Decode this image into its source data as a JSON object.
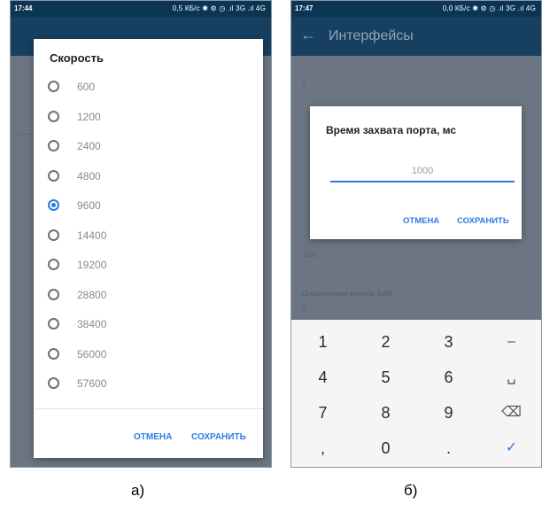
{
  "screen_a": {
    "statusbar": {
      "time": "17:44",
      "status": "0,5 КБ/с ✱ ⚙ ◷ .ıl 3G .ıl 4G"
    },
    "dialog": {
      "title": "Скорость",
      "options": [
        "600",
        "1200",
        "2400",
        "4800",
        "9600",
        "14400",
        "19200",
        "28800",
        "38400",
        "56000",
        "57600"
      ],
      "selected": "9600",
      "cancel_label": "ОТМЕНА",
      "save_label": "СОХРАНИТЬ"
    },
    "caption": "а)"
  },
  "screen_b": {
    "statusbar": {
      "time": "17:47",
      "status": "0,0 КБ/с ✱ ⚙ ◷ .ıl 3G .ıl 4G"
    },
    "appbar": {
      "back_icon": "arrow-left-icon",
      "title": "Интерфейсы"
    },
    "background": {
      "value1": "1",
      "value2": "1000",
      "label3": "Ограничение пакета, байт",
      "value3": "0"
    },
    "dialog": {
      "title": "Время захвата порта, мс",
      "input_value": "1000",
      "cancel_label": "ОТМЕНА",
      "save_label": "СОХРАНИТЬ"
    },
    "keypad": {
      "keys": [
        "1",
        "2",
        "3",
        "–",
        "4",
        "5",
        "6",
        "␣",
        "7",
        "8",
        "9",
        "⌫",
        ",",
        "0",
        ".",
        "✓"
      ]
    },
    "caption": "б)"
  },
  "colors": {
    "accent": "#2b7de0",
    "appbar": "#163f60",
    "statusbar": "#0b3554",
    "dim": "#6b7682"
  }
}
